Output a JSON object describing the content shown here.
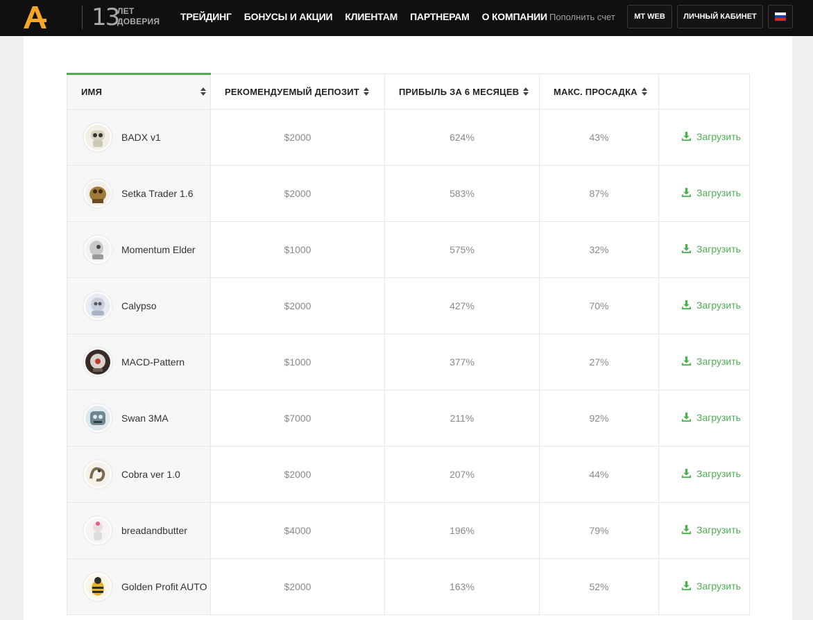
{
  "header": {
    "logo_icon": "broker-logo-icon",
    "years_number": "13",
    "years_line1": "ЛЕТ",
    "years_line2": "ДОВЕРИЯ",
    "nav": [
      "ТРЕЙДИНГ",
      "БОНУСЫ И АКЦИИ",
      "КЛИЕНТАМ",
      "ПАРТНЕРАМ",
      "О КОМПАНИИ"
    ],
    "topup_link": "Пополнить счет",
    "mt_web_button": "MT WEB",
    "cabinet_button": "ЛИЧНЫЙ КАБИНЕТ",
    "language_icon": "russian-flag-icon",
    "accent_color": "#f5a623"
  },
  "table": {
    "columns": [
      "ИМЯ",
      "РЕКОМЕНДУЕМЫЙ ДЕПОЗИТ",
      "ПРИБЫЛЬ ЗА 6 МЕСЯЦЕВ",
      "МАКС. ПРОСАДКА",
      ""
    ],
    "download_label": "Загрузить",
    "download_icon": "download-icon",
    "accent_color": "#4caf50",
    "rows": [
      {
        "name": "BADX v1",
        "deposit": "$2000",
        "profit": "624%",
        "drawdown": "43%"
      },
      {
        "name": "Setka Trader 1.6",
        "deposit": "$2000",
        "profit": "583%",
        "drawdown": "87%"
      },
      {
        "name": "Momentum Elder",
        "deposit": "$1000",
        "profit": "575%",
        "drawdown": "32%"
      },
      {
        "name": "Calypso",
        "deposit": "$2000",
        "profit": "427%",
        "drawdown": "70%"
      },
      {
        "name": "MACD-Pattern",
        "deposit": "$1000",
        "profit": "377%",
        "drawdown": "27%"
      },
      {
        "name": "Swan 3MA",
        "deposit": "$7000",
        "profit": "211%",
        "drawdown": "92%"
      },
      {
        "name": "Cobra ver 1.0",
        "deposit": "$2000",
        "profit": "207%",
        "drawdown": "44%"
      },
      {
        "name": "breadandbutter",
        "deposit": "$4000",
        "profit": "196%",
        "drawdown": "79%"
      },
      {
        "name": "Golden Profit AUTO",
        "deposit": "$2000",
        "profit": "163%",
        "drawdown": "52%"
      }
    ]
  }
}
